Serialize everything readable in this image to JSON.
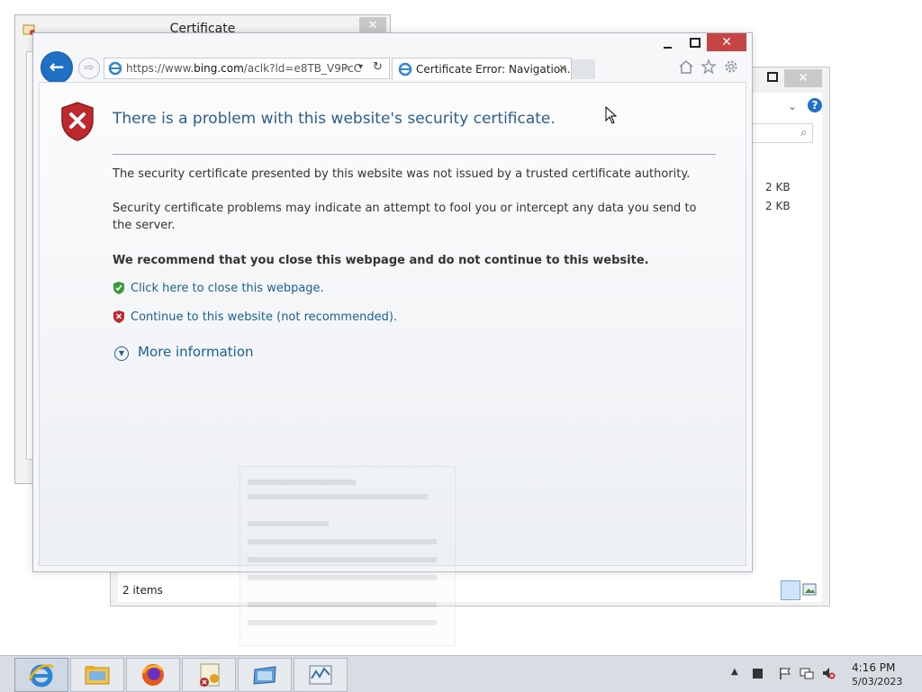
{
  "cert_dialog": {
    "title": "Certificate",
    "close": "✕"
  },
  "explorer": {
    "close": "✕",
    "help": "?",
    "sizes": [
      "2 KB",
      "2 KB"
    ],
    "status": "2 items"
  },
  "browser": {
    "close": "✕",
    "back_glyph": "←",
    "fwd_glyph": "⇨",
    "address_prefix": "https://www.",
    "address_domain": "bing.com",
    "address_suffix": "/aclk?ld=e8TB_V9PcC",
    "tab_label": "Certificate Error: Navigation...",
    "tab_close": "✕"
  },
  "page": {
    "title": "There is a problem with this website's security certificate.",
    "p1": "The security certificate presented by this website was not issued by a trusted certificate authority.",
    "p2": "Security certificate problems may indicate an attempt to fool you or intercept any data you send to the server.",
    "recommend": "We recommend that you close this webpage and do not continue to this website.",
    "close_link": "Click here to close this webpage.",
    "continue_link": "Continue to this website (not recommended).",
    "more_info": "More information"
  },
  "taskbar": {
    "apps": [
      "internet-explorer",
      "file-explorer",
      "firefox",
      "certificate-manager",
      "server-manager",
      "performance-monitor"
    ],
    "time": "4:16 PM",
    "date": "5/03/2023"
  },
  "colors": {
    "link": "#1d5f93",
    "title": "#2b5d93",
    "close_red": "#c74444",
    "back_blue": "#1f6fc5"
  }
}
